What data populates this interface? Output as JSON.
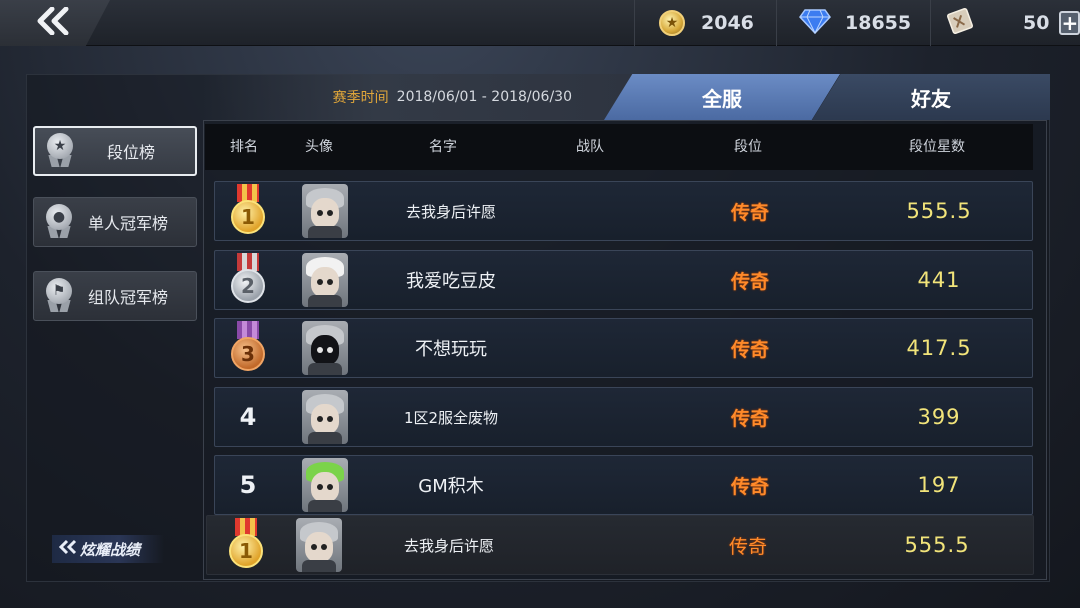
{
  "topbar": {
    "back_icon": "double-chevron-left-icon",
    "gold": "2046",
    "diamond": "18655",
    "tickets": "50",
    "plus_icon": "plus-icon"
  },
  "season": {
    "label": "赛季时间",
    "range": "2018/06/01 - 2018/06/30"
  },
  "tabs": [
    {
      "label": "全服",
      "active": true
    },
    {
      "label": "好友",
      "active": false
    }
  ],
  "sidebar": [
    {
      "label": "段位榜",
      "active": true
    },
    {
      "label": "单人冠军榜",
      "active": false
    },
    {
      "label": "组队冠军榜",
      "active": false
    }
  ],
  "glory_button": "炫耀战绩",
  "table": {
    "headers": [
      "排名",
      "头像",
      "名字",
      "战队",
      "段位",
      "段位星数"
    ],
    "rows": [
      {
        "rank": "1",
        "medal": "gold",
        "name": "去我身后许愿",
        "team": "",
        "tier": "传奇",
        "stars": "555.5"
      },
      {
        "rank": "2",
        "medal": "silver",
        "name": "我爱吃豆皮",
        "team": "",
        "tier": "传奇",
        "stars": "441"
      },
      {
        "rank": "3",
        "medal": "bronze",
        "name": "不想玩玩",
        "team": "",
        "tier": "传奇",
        "stars": "417.5"
      },
      {
        "rank": "4",
        "medal": "",
        "name": "1区2服全废物",
        "team": "",
        "tier": "传奇",
        "stars": "399"
      },
      {
        "rank": "5",
        "medal": "",
        "name": "GM积木",
        "team": "",
        "tier": "传奇",
        "stars": "197"
      }
    ],
    "my_row": {
      "rank": "1",
      "medal": "gold",
      "name": "去我身后许愿",
      "team": "",
      "tier": "传奇",
      "stars": "555.5"
    }
  },
  "colors": {
    "tier": "#ff8a2a",
    "stars": "#f2e47a",
    "season_label": "#e0a63a",
    "tab_active": "#5b7bb4"
  }
}
